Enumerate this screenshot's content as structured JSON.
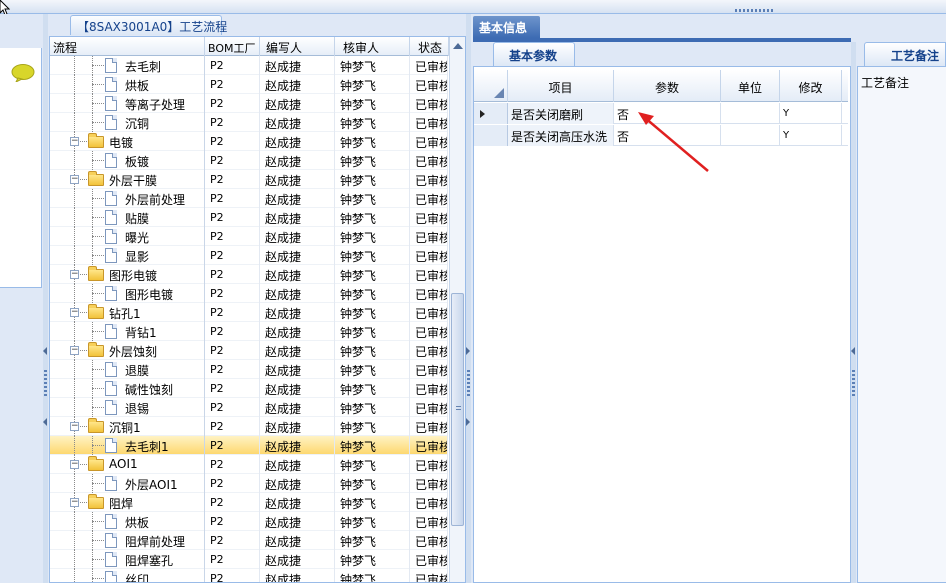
{
  "tree_panel": {
    "tab_title": "【8SAX3001A0】工艺流程",
    "columns": [
      "流程",
      "BOM工厂",
      "编写人",
      "核审人",
      "状态"
    ],
    "rows": [
      {
        "name": "去毛刺",
        "type": "doc",
        "bom": "P2",
        "writer": "赵成捷",
        "reviewer": "钟梦飞",
        "status": "已审核"
      },
      {
        "name": "烘板",
        "type": "doc",
        "bom": "P2",
        "writer": "赵成捷",
        "reviewer": "钟梦飞",
        "status": "已审核"
      },
      {
        "name": "等离子处理",
        "type": "doc",
        "bom": "P2",
        "writer": "赵成捷",
        "reviewer": "钟梦飞",
        "status": "已审核"
      },
      {
        "name": "沉铜",
        "type": "doc",
        "bom": "P2",
        "writer": "赵成捷",
        "reviewer": "钟梦飞",
        "status": "已审核"
      },
      {
        "name": "电镀",
        "type": "folder",
        "bom": "P2",
        "writer": "赵成捷",
        "reviewer": "钟梦飞",
        "status": "已审核"
      },
      {
        "name": "板镀",
        "type": "doc",
        "bom": "P2",
        "writer": "赵成捷",
        "reviewer": "钟梦飞",
        "status": "已审核"
      },
      {
        "name": "外层干膜",
        "type": "folder",
        "bom": "P2",
        "writer": "赵成捷",
        "reviewer": "钟梦飞",
        "status": "已审核"
      },
      {
        "name": "外层前处理",
        "type": "doc",
        "bom": "P2",
        "writer": "赵成捷",
        "reviewer": "钟梦飞",
        "status": "已审核"
      },
      {
        "name": "贴膜",
        "type": "doc",
        "bom": "P2",
        "writer": "赵成捷",
        "reviewer": "钟梦飞",
        "status": "已审核"
      },
      {
        "name": "曝光",
        "type": "doc",
        "bom": "P2",
        "writer": "赵成捷",
        "reviewer": "钟梦飞",
        "status": "已审核"
      },
      {
        "name": "显影",
        "type": "doc",
        "bom": "P2",
        "writer": "赵成捷",
        "reviewer": "钟梦飞",
        "status": "已审核"
      },
      {
        "name": "图形电镀",
        "type": "folder",
        "bom": "P2",
        "writer": "赵成捷",
        "reviewer": "钟梦飞",
        "status": "已审核"
      },
      {
        "name": "图形电镀",
        "type": "doc",
        "bom": "P2",
        "writer": "赵成捷",
        "reviewer": "钟梦飞",
        "status": "已审核"
      },
      {
        "name": "钻孔1",
        "type": "folder",
        "bom": "P2",
        "writer": "赵成捷",
        "reviewer": "钟梦飞",
        "status": "已审核"
      },
      {
        "name": "背钻1",
        "type": "doc",
        "bom": "P2",
        "writer": "赵成捷",
        "reviewer": "钟梦飞",
        "status": "已审核"
      },
      {
        "name": "外层蚀刻",
        "type": "folder",
        "bom": "P2",
        "writer": "赵成捷",
        "reviewer": "钟梦飞",
        "status": "已审核"
      },
      {
        "name": "退膜",
        "type": "doc",
        "bom": "P2",
        "writer": "赵成捷",
        "reviewer": "钟梦飞",
        "status": "已审核"
      },
      {
        "name": "碱性蚀刻",
        "type": "doc",
        "bom": "P2",
        "writer": "赵成捷",
        "reviewer": "钟梦飞",
        "status": "已审核"
      },
      {
        "name": "退锡",
        "type": "doc",
        "bom": "P2",
        "writer": "赵成捷",
        "reviewer": "钟梦飞",
        "status": "已审核"
      },
      {
        "name": "沉铜1",
        "type": "folder",
        "bom": "P2",
        "writer": "赵成捷",
        "reviewer": "钟梦飞",
        "status": "已审核"
      },
      {
        "name": "去毛刺1",
        "type": "doc",
        "bom": "P2",
        "writer": "赵成捷",
        "reviewer": "钟梦飞",
        "status": "已审核",
        "selected": true
      },
      {
        "name": "AOI1",
        "type": "folder",
        "bom": "P2",
        "writer": "赵成捷",
        "reviewer": "钟梦飞",
        "status": "已审核"
      },
      {
        "name": "外层AOI1",
        "type": "doc",
        "bom": "P2",
        "writer": "赵成捷",
        "reviewer": "钟梦飞",
        "status": "已审核"
      },
      {
        "name": "阻焊",
        "type": "folder",
        "bom": "P2",
        "writer": "赵成捷",
        "reviewer": "钟梦飞",
        "status": "已审核"
      },
      {
        "name": "烘板",
        "type": "doc",
        "bom": "P2",
        "writer": "赵成捷",
        "reviewer": "钟梦飞",
        "status": "已审核"
      },
      {
        "name": "阻焊前处理",
        "type": "doc",
        "bom": "P2",
        "writer": "赵成捷",
        "reviewer": "钟梦飞",
        "status": "已审核"
      },
      {
        "name": "阻焊塞孔",
        "type": "doc",
        "bom": "P2",
        "writer": "赵成捷",
        "reviewer": "钟梦飞",
        "status": "已审核"
      },
      {
        "name": "丝印",
        "type": "doc",
        "bom": "P2",
        "writer": "赵成捷",
        "reviewer": "钟梦飞",
        "status": "已审核"
      }
    ]
  },
  "basic_info": {
    "tab_label": "基本信息",
    "sub_tab_label": "基本参数",
    "columns": [
      "项目",
      "参数",
      "单位",
      "修改"
    ],
    "rows": [
      {
        "item": "是否关闭磨刷",
        "value": "否",
        "unit": "",
        "modify": "Y"
      },
      {
        "item": "是否关闭高压水洗",
        "value": "否",
        "unit": "",
        "modify": "Y"
      }
    ]
  },
  "note_panel": {
    "tab_label": "工艺备注",
    "field_label": "工艺备注"
  },
  "colors": {
    "accent_blue": "#3d6bb3",
    "selection_yellow": "#fdd870",
    "annotation_red": "#e02020"
  }
}
